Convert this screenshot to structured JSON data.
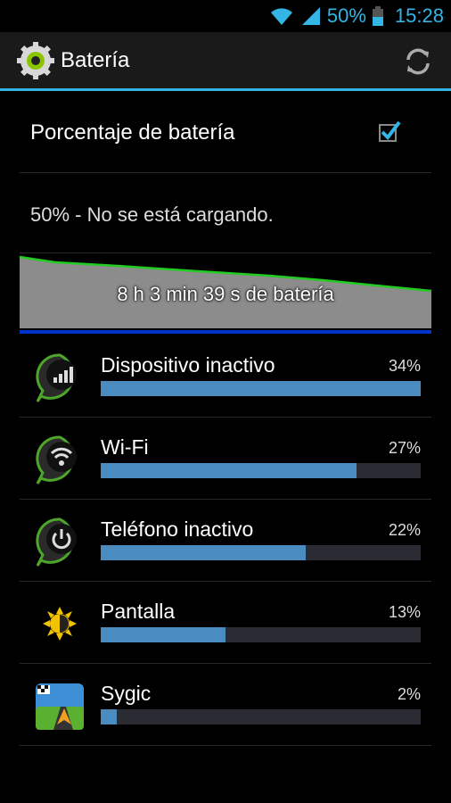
{
  "status_bar": {
    "battery_percent": "50%",
    "time": "15:28"
  },
  "action_bar": {
    "title": "Batería"
  },
  "battery_percentage_setting": {
    "label": "Porcentaje de batería",
    "checked": true
  },
  "battery_status": {
    "text": "50% - No se está cargando."
  },
  "battery_graph": {
    "label": "8 h 3 min 39 s de batería"
  },
  "usage": [
    {
      "name": "Dispositivo inactivo",
      "percent_label": "34%",
      "fraction": 1.0,
      "icon": "signal-icon"
    },
    {
      "name": "Wi-Fi",
      "percent_label": "27%",
      "fraction": 0.8,
      "icon": "wifi-icon"
    },
    {
      "name": "Teléfono inactivo",
      "percent_label": "22%",
      "fraction": 0.64,
      "icon": "power-icon"
    },
    {
      "name": "Pantalla",
      "percent_label": "13%",
      "fraction": 0.39,
      "icon": "brightness-icon"
    },
    {
      "name": "Sygic",
      "percent_label": "2%",
      "fraction": 0.05,
      "icon": "sygic-navigation-icon"
    }
  ],
  "colors": {
    "accent": "#33b5e5",
    "bar_fill": "#4a8cc0",
    "graph_line": "#22cc22"
  }
}
